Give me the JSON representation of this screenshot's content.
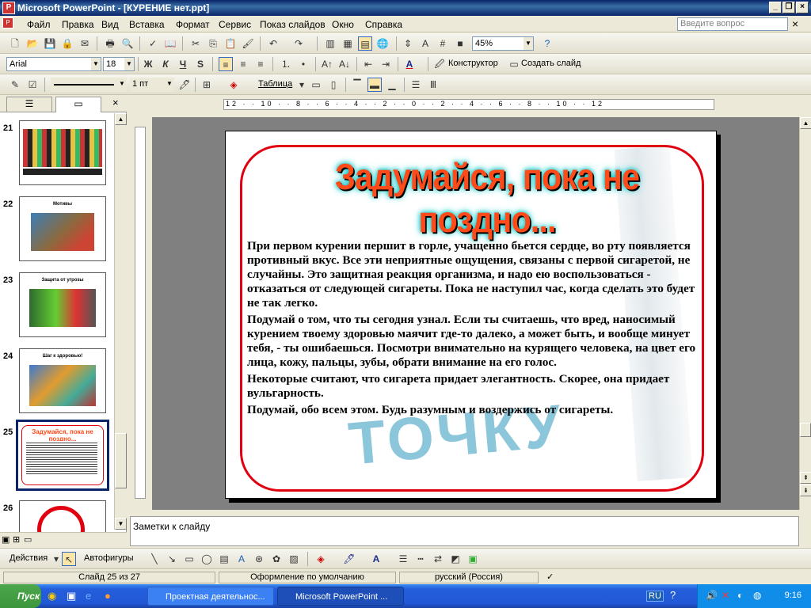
{
  "window": {
    "title": "Microsoft PowerPoint - [КУРЕНИЕ нет.ppt]"
  },
  "menu": [
    "Файл",
    "Правка",
    "Вид",
    "Вставка",
    "Формат",
    "Сервис",
    "Показ слайдов",
    "Окно",
    "Справка"
  ],
  "ask_placeholder": "Введите вопрос",
  "toolbar1": {
    "zoom": "45%"
  },
  "toolbar2": {
    "font": "Arial",
    "size": "18",
    "bold": "Ж",
    "italic": "К",
    "underline": "Ч",
    "shadow": "S",
    "designer": "Конструктор",
    "new_slide": "Создать слайд"
  },
  "toolbar3": {
    "line_width": "1 пт",
    "table": "Таблица"
  },
  "ruler_h": "12 · · 10 · · 8 · · 6 · · 4 · · 2 · · 0 · · 2 · · 4 · · 6 · · 8 · · 10 · · 12",
  "slides": [
    {
      "num": "21",
      "title": ""
    },
    {
      "num": "22",
      "title": "Мотивы"
    },
    {
      "num": "23",
      "title": "Защита от угрозы"
    },
    {
      "num": "24",
      "title": "Шаг к здоровью!"
    },
    {
      "num": "25",
      "title": "Задумайся, пока не поздно..."
    },
    {
      "num": "26",
      "title": ""
    }
  ],
  "slide": {
    "title": "Задумайся, пока не поздно...",
    "paragraphs": [
      " При первом курении першит в горле, учащенно бьется сердце, во рту появляется противный вкус. Все эти неприятные ощущения, связаны с первой сигаретой, не случайны. Это защитная реакция организма, и надо ею воспользоваться - отказаться от следующей сигареты. Пока не наступил час, когда сделать это будет не так легко.",
      "Подумай о том, что  ты сегодня узнал. Если ты считаешь, что вред, наносимый курением твоему здоровью маячит где-то далеко, а может быть, и вообще минует тебя, - ты ошибаешься. Посмотри внимательно на курящего человека, на цвет его лица, кожу, пальцы, зубы, обрати внимание на его голос.",
      "Некоторые считают, что сигарета придает  элегантность. Скорее, она придает вульгарность.",
      "Подумай,  обо всем этом. Будь разумным и воздержись от сигареты."
    ],
    "watermark": "ТОЧКУ"
  },
  "notes_placeholder": "Заметки к слайду",
  "drawbar": {
    "actions": "Действия",
    "autoshapes": "Автофигуры"
  },
  "status": {
    "slide": "Слайд 25 из 27",
    "design": "Оформление по умолчанию",
    "lang": "русский (Россия)"
  },
  "taskbar": {
    "start": "Пуск",
    "task1": "Проектная деятельнос...",
    "task2": "Microsoft PowerPoint ...",
    "lang": "RU",
    "clock": "9:16"
  }
}
